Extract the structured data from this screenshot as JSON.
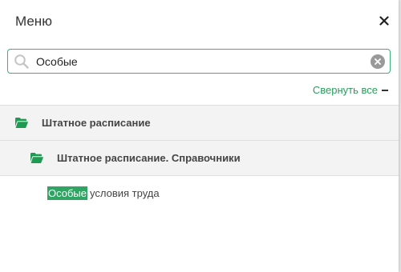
{
  "header": {
    "title": "Меню"
  },
  "search": {
    "value": "Особые"
  },
  "collapse": {
    "label": "Свернуть все"
  },
  "tree": {
    "level1": {
      "label": "Штатное расписание"
    },
    "level2": {
      "label": "Штатное расписание. Справочники"
    },
    "leaf": {
      "match": "Особые",
      "rest": "условия труда"
    }
  },
  "colors": {
    "accent": "#2fa463",
    "folder": "#1e9a53",
    "clear_button": "#9a9a9a"
  },
  "icons": {
    "close": "close-icon",
    "search": "search-icon",
    "clear": "clear-icon",
    "folder": "folder-open-icon"
  }
}
